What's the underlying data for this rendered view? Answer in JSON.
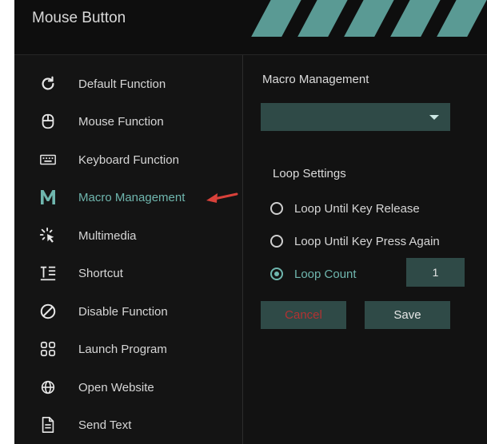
{
  "window": {
    "title": "Mouse Button",
    "accent_color": "#6fb6ae",
    "panel_color": "#2f4a47",
    "danger_color": "#b23232"
  },
  "sidebar": {
    "items": [
      {
        "label": "Default Function",
        "icon": "refresh-icon",
        "active": false
      },
      {
        "label": "Mouse Function",
        "icon": "mouse-icon",
        "active": false
      },
      {
        "label": "Keyboard Function",
        "icon": "keyboard-icon",
        "active": false
      },
      {
        "label": "Macro Management",
        "icon": "macro-m-icon",
        "active": true
      },
      {
        "label": "Multimedia",
        "icon": "multimedia-cursor-icon",
        "active": false
      },
      {
        "label": "Shortcut",
        "icon": "shortcut-text-icon",
        "active": false
      },
      {
        "label": "Disable Function",
        "icon": "disable-icon",
        "active": false
      },
      {
        "label": "Launch Program",
        "icon": "launch-grid-icon",
        "active": false
      },
      {
        "label": "Open Website",
        "icon": "globe-icon",
        "active": false
      },
      {
        "label": "Send Text",
        "icon": "document-icon",
        "active": false
      }
    ]
  },
  "panel": {
    "title": "Macro Management",
    "dropdown_value": "",
    "loop_settings_title": "Loop Settings",
    "options": [
      {
        "label": "Loop Until Key Release",
        "checked": false
      },
      {
        "label": "Loop Until Key Press Again",
        "checked": false
      },
      {
        "label": "Loop Count",
        "checked": true
      }
    ],
    "loop_count_value": "1",
    "cancel_label": "Cancel",
    "save_label": "Save"
  }
}
